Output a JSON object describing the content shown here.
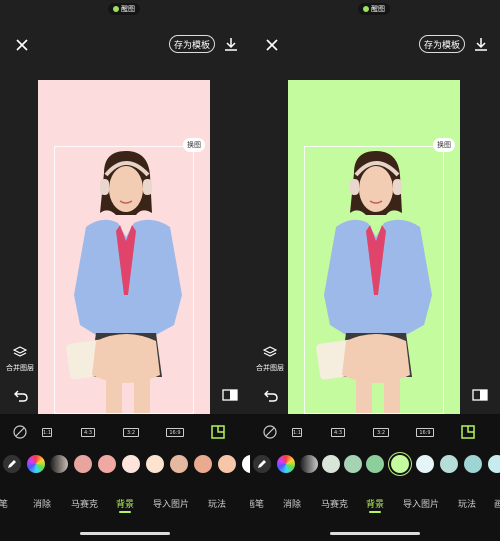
{
  "colors": {
    "accent": "#b6f55a",
    "left_background": "#fcdcdc",
    "right_background": "#c4fb9f"
  },
  "screens": [
    {
      "status_pill": "醒图",
      "template_button": "存为模板",
      "swap_button": "换图",
      "merge_layers": "合并图层",
      "ratios": [
        "1:1",
        "4:3",
        "3:2",
        "16:9"
      ],
      "swatches": [
        "#3a2e2a",
        "#e8a49e",
        "#f0a8a2",
        "#fce3dc",
        "#fbe3cf",
        "#e6b89f",
        "#eba98f",
        "#f5c6a8",
        "#ffffff"
      ],
      "selected_swatch": -1,
      "tabs": [
        "画笔",
        "消除",
        "马赛克",
        "背景",
        "导入图片",
        "玩法"
      ],
      "active_tab": 3
    },
    {
      "status_pill": "醒图",
      "template_button": "存为模板",
      "swap_button": "换图",
      "merge_layers": "合并图层",
      "ratios": [
        "1:1",
        "4:3",
        "3:2",
        "16:9"
      ],
      "swatches": [
        "#3c3c3c",
        "#d8e5d9",
        "#a6d3b3",
        "#8ccf9a",
        "#c4fb9f",
        "#e4f4f7",
        "#b6ddd8",
        "#9fd4d4",
        "#c6ecef"
      ],
      "selected_swatch": 4,
      "tabs": [
        "画笔",
        "消除",
        "马赛克",
        "背景",
        "导入图片",
        "玩法",
        "画笔"
      ],
      "active_tab": 3
    }
  ]
}
